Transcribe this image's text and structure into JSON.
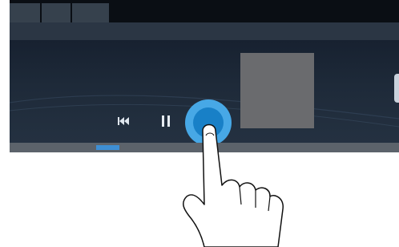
{
  "player": {
    "tabs": [
      "",
      "",
      ""
    ],
    "progress": {
      "value": 0.12
    },
    "controls": {
      "previous_icon": "skip-previous-icon",
      "pause_icon": "pause-icon",
      "play_icon": "play-icon"
    },
    "album_art": "album-art-placeholder"
  },
  "colors": {
    "background": "#0f1622",
    "accent": "#3e8fd4",
    "play_ring": "#47a8e6",
    "play_core": "#1880c7",
    "progress_track": "#5c636b"
  },
  "overlay": {
    "gesture": "tap-hand-icon"
  }
}
